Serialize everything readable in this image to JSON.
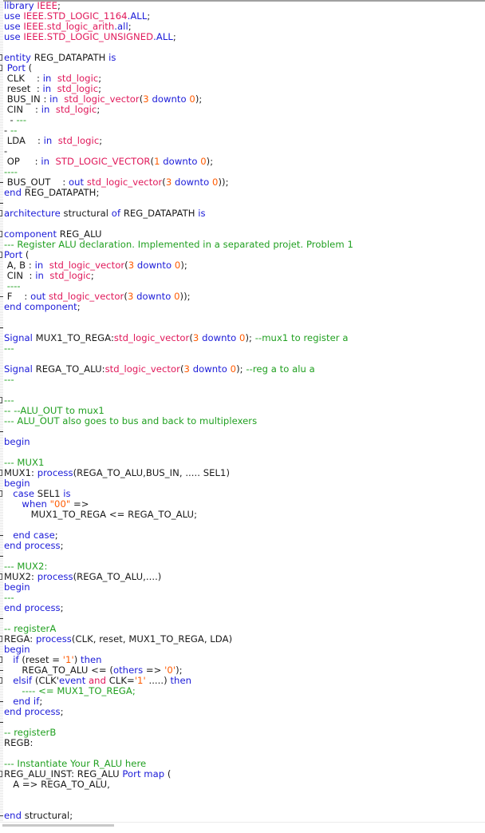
{
  "editor": {
    "language": "VHDL",
    "colors": {
      "keyword": "#1a1ad8",
      "type": "#e0185a",
      "number": "#ff5a00",
      "comment": "#21a021",
      "identifier": "#1a1a1a"
    },
    "lines": [
      {
        "marker": "",
        "tokens": [
          [
            "kw",
            "library "
          ],
          [
            "ty",
            "IEEE"
          ],
          [
            "id",
            ";"
          ]
        ]
      },
      {
        "marker": "",
        "tokens": [
          [
            "kw",
            "use "
          ],
          [
            "ty",
            "IEEE.STD_LOGIC_1164"
          ],
          [
            "kw",
            ".ALL"
          ],
          [
            "id",
            ";"
          ]
        ]
      },
      {
        "marker": "",
        "tokens": [
          [
            "kw",
            "use "
          ],
          [
            "ty",
            "IEEE.std_logic_arith"
          ],
          [
            "kw",
            ".all"
          ],
          [
            "id",
            ";"
          ]
        ]
      },
      {
        "marker": "",
        "tokens": [
          [
            "kw",
            "use "
          ],
          [
            "ty",
            "IEEE.STD_LOGIC_UNSIGNED"
          ],
          [
            "kw",
            ".ALL"
          ],
          [
            "id",
            ";"
          ]
        ]
      },
      {
        "marker": "",
        "tokens": []
      },
      {
        "marker": "fold",
        "tokens": [
          [
            "kw",
            "entity "
          ],
          [
            "id",
            "REG_DATAPATH "
          ],
          [
            "kw",
            "is"
          ]
        ]
      },
      {
        "marker": "fold",
        "tokens": [
          [
            "kw",
            " Port "
          ],
          [
            "id",
            "("
          ]
        ]
      },
      {
        "marker": "",
        "tokens": [
          [
            "id",
            " CLK    : "
          ],
          [
            "kw",
            "in  "
          ],
          [
            "ty",
            "std_logic"
          ],
          [
            "id",
            ";"
          ]
        ]
      },
      {
        "marker": "",
        "tokens": [
          [
            "id",
            " reset  : "
          ],
          [
            "kw",
            "in  "
          ],
          [
            "ty",
            "std_logic"
          ],
          [
            "id",
            ";"
          ]
        ]
      },
      {
        "marker": "",
        "tokens": [
          [
            "id",
            " BUS_IN : "
          ],
          [
            "kw",
            "in  "
          ],
          [
            "ty",
            "std_logic_vector"
          ],
          [
            "id",
            "("
          ],
          [
            "num",
            "3"
          ],
          [
            "kw",
            " downto "
          ],
          [
            "num",
            "0"
          ],
          [
            "id",
            "); "
          ]
        ]
      },
      {
        "marker": "",
        "tokens": [
          [
            "id",
            " CIN    : "
          ],
          [
            "kw",
            "in  "
          ],
          [
            "ty",
            "std_logic"
          ],
          [
            "id",
            ";"
          ]
        ]
      },
      {
        "marker": "",
        "tokens": [
          [
            "id",
            "  - "
          ],
          [
            "cm",
            "---"
          ]
        ]
      },
      {
        "marker": "",
        "tokens": [
          [
            "id",
            "- "
          ],
          [
            "cm",
            "--"
          ]
        ]
      },
      {
        "marker": "",
        "tokens": [
          [
            "id",
            " LDA    : "
          ],
          [
            "kw",
            "in  "
          ],
          [
            "ty",
            "std_logic"
          ],
          [
            "id",
            ";"
          ]
        ]
      },
      {
        "marker": "",
        "tokens": [
          [
            "id",
            "-"
          ]
        ]
      },
      {
        "marker": "",
        "tokens": [
          [
            "id",
            " OP     : "
          ],
          [
            "kw",
            "in  "
          ],
          [
            "ty",
            "STD_LOGIC_VECTOR"
          ],
          [
            "id",
            "("
          ],
          [
            "num",
            "1"
          ],
          [
            "kw",
            " downto "
          ],
          [
            "num",
            "0"
          ],
          [
            "id",
            ");"
          ]
        ]
      },
      {
        "marker": "",
        "tokens": [
          [
            "cm",
            "----"
          ]
        ]
      },
      {
        "marker": "dash",
        "tokens": [
          [
            "id",
            " BUS_OUT    : "
          ],
          [
            "kw",
            "out "
          ],
          [
            "ty",
            "std_logic_vector"
          ],
          [
            "id",
            "("
          ],
          [
            "num",
            "3"
          ],
          [
            "kw",
            " downto "
          ],
          [
            "num",
            "0"
          ],
          [
            "id",
            "));"
          ]
        ]
      },
      {
        "marker": "",
        "tokens": [
          [
            "kw",
            "end "
          ],
          [
            "id",
            "REG_DATAPATH;"
          ]
        ]
      },
      {
        "marker": "dash",
        "tokens": []
      },
      {
        "marker": "fold",
        "tokens": [
          [
            "kw",
            "architecture "
          ],
          [
            "id",
            "structural "
          ],
          [
            "kw",
            "of "
          ],
          [
            "id",
            "REG_DATAPATH "
          ],
          [
            "kw",
            "is"
          ]
        ]
      },
      {
        "marker": "",
        "tokens": []
      },
      {
        "marker": "fold",
        "tokens": [
          [
            "kw",
            "component "
          ],
          [
            "id",
            "REG_ALU"
          ]
        ]
      },
      {
        "marker": "",
        "tokens": [
          [
            "cm",
            "--- Register ALU declaration. Implemented in a separated projet. Problem 1"
          ]
        ]
      },
      {
        "marker": "fold",
        "tokens": [
          [
            "kw",
            "Port "
          ],
          [
            "id",
            "("
          ]
        ]
      },
      {
        "marker": "",
        "tokens": [
          [
            "id",
            " A, B : "
          ],
          [
            "kw",
            "in  "
          ],
          [
            "ty",
            "std_logic_vector"
          ],
          [
            "id",
            "("
          ],
          [
            "num",
            "3"
          ],
          [
            "kw",
            " downto "
          ],
          [
            "num",
            "0"
          ],
          [
            "id",
            ");"
          ]
        ]
      },
      {
        "marker": "",
        "tokens": [
          [
            "id",
            " CIN  : "
          ],
          [
            "kw",
            "in  "
          ],
          [
            "ty",
            "std_logic"
          ],
          [
            "id",
            ";"
          ]
        ]
      },
      {
        "marker": "",
        "tokens": [
          [
            "cm",
            " ----"
          ]
        ]
      },
      {
        "marker": "dash",
        "tokens": [
          [
            "id",
            " F    : "
          ],
          [
            "kw",
            "out "
          ],
          [
            "ty",
            "std_logic_vector"
          ],
          [
            "id",
            "("
          ],
          [
            "num",
            "3"
          ],
          [
            "kw",
            " downto "
          ],
          [
            "num",
            "0"
          ],
          [
            "id",
            "));"
          ]
        ]
      },
      {
        "marker": "",
        "tokens": [
          [
            "kw",
            "end component"
          ],
          [
            "id",
            ";"
          ]
        ]
      },
      {
        "marker": "",
        "tokens": []
      },
      {
        "marker": "dash",
        "tokens": []
      },
      {
        "marker": "",
        "tokens": [
          [
            "kw",
            "Signal "
          ],
          [
            "id",
            "MUX1_TO_REGA:"
          ],
          [
            "ty",
            "std_logic_vector"
          ],
          [
            "id",
            "("
          ],
          [
            "num",
            "3"
          ],
          [
            "kw",
            " downto "
          ],
          [
            "num",
            "0"
          ],
          [
            "id",
            "); "
          ],
          [
            "cm",
            "--mux1 to register a"
          ]
        ]
      },
      {
        "marker": "",
        "tokens": [
          [
            "cm",
            "---"
          ]
        ]
      },
      {
        "marker": "",
        "tokens": []
      },
      {
        "marker": "",
        "tokens": [
          [
            "kw",
            "Signal "
          ],
          [
            "id",
            "REGA_TO_ALU:"
          ],
          [
            "ty",
            "std_logic_vector"
          ],
          [
            "id",
            "("
          ],
          [
            "num",
            "3"
          ],
          [
            "kw",
            " downto "
          ],
          [
            "num",
            "0"
          ],
          [
            "id",
            "); "
          ],
          [
            "cm",
            "--reg a to alu a"
          ]
        ]
      },
      {
        "marker": "",
        "tokens": [
          [
            "cm",
            "---"
          ]
        ]
      },
      {
        "marker": "",
        "tokens": []
      },
      {
        "marker": "fold",
        "tokens": [
          [
            "cm",
            "---"
          ]
        ]
      },
      {
        "marker": "",
        "tokens": [
          [
            "cm",
            "-- --ALU_OUT to mux1"
          ]
        ]
      },
      {
        "marker": "",
        "tokens": [
          [
            "cm",
            "--- ALU_OUT also goes to bus and back to multiplexers"
          ]
        ]
      },
      {
        "marker": "dash",
        "tokens": []
      },
      {
        "marker": "",
        "tokens": [
          [
            "kw",
            "begin"
          ]
        ]
      },
      {
        "marker": "",
        "tokens": []
      },
      {
        "marker": "",
        "tokens": [
          [
            "cm",
            "--- MUX1"
          ]
        ]
      },
      {
        "marker": "fold",
        "tokens": [
          [
            "id",
            "MUX1: "
          ],
          [
            "kw",
            "process"
          ],
          [
            "id",
            "(REGA_TO_ALU,BUS_IN, ..... SEL1)"
          ]
        ]
      },
      {
        "marker": "",
        "tokens": [
          [
            "kw",
            "begin"
          ]
        ]
      },
      {
        "marker": "fold",
        "tokens": [
          [
            "kw",
            "   case "
          ],
          [
            "id",
            "SEL1 "
          ],
          [
            "kw",
            "is"
          ]
        ]
      },
      {
        "marker": "",
        "tokens": [
          [
            "kw",
            "      when "
          ],
          [
            "str",
            "\"00\""
          ],
          [
            "id",
            " =>"
          ]
        ]
      },
      {
        "marker": "",
        "tokens": [
          [
            "id",
            "         MUX1_TO_REGA <= REGA_TO_ALU;"
          ]
        ]
      },
      {
        "marker": "",
        "tokens": []
      },
      {
        "marker": "dash",
        "tokens": [
          [
            "kw",
            "   end case"
          ],
          [
            "id",
            ";"
          ]
        ]
      },
      {
        "marker": "",
        "tokens": [
          [
            "kw",
            "end process"
          ],
          [
            "id",
            ";"
          ]
        ]
      },
      {
        "marker": "dash",
        "tokens": []
      },
      {
        "marker": "",
        "tokens": [
          [
            "cm",
            "--- MUX2:"
          ]
        ]
      },
      {
        "marker": "fold",
        "tokens": [
          [
            "id",
            "MUX2: "
          ],
          [
            "kw",
            "process"
          ],
          [
            "id",
            "(REGA_TO_ALU,....)"
          ]
        ]
      },
      {
        "marker": "",
        "tokens": [
          [
            "kw",
            "begin"
          ]
        ]
      },
      {
        "marker": "",
        "tokens": [
          [
            "cm",
            "---"
          ]
        ]
      },
      {
        "marker": "",
        "tokens": [
          [
            "kw",
            "end process"
          ],
          [
            "id",
            ";"
          ]
        ]
      },
      {
        "marker": "dash",
        "tokens": []
      },
      {
        "marker": "",
        "tokens": [
          [
            "cm",
            "-- registerA"
          ]
        ]
      },
      {
        "marker": "fold",
        "tokens": [
          [
            "id",
            "REGA: "
          ],
          [
            "kw",
            "process"
          ],
          [
            "id",
            "(CLK, reset, MUX1_TO_REGA, LDA)"
          ]
        ]
      },
      {
        "marker": "",
        "tokens": [
          [
            "kw",
            "begin"
          ]
        ]
      },
      {
        "marker": "fold",
        "tokens": [
          [
            "kw",
            "   if "
          ],
          [
            "id",
            "(reset = "
          ],
          [
            "str",
            "'1'"
          ],
          [
            "id",
            ") "
          ],
          [
            "kw",
            "then"
          ]
        ]
      },
      {
        "marker": "dash",
        "tokens": [
          [
            "id",
            "      REGA_TO_ALU <= ("
          ],
          [
            "kw",
            "others"
          ],
          [
            "id",
            " => "
          ],
          [
            "str",
            "'0'"
          ],
          [
            "id",
            ");"
          ]
        ]
      },
      {
        "marker": "fold",
        "tokens": [
          [
            "kw",
            "   elsif "
          ],
          [
            "id",
            "(CLK'"
          ],
          [
            "kw",
            "event "
          ],
          [
            "op",
            "and "
          ],
          [
            "id",
            "CLK="
          ],
          [
            "str",
            "'1'"
          ],
          [
            "id",
            " .....) "
          ],
          [
            "kw",
            "then"
          ]
        ]
      },
      {
        "marker": "",
        "tokens": [
          [
            "cm",
            "      ---- <= MUX1_TO_REGA;"
          ]
        ]
      },
      {
        "marker": "dash",
        "tokens": [
          [
            "kw",
            "   end if"
          ],
          [
            "id",
            ";"
          ]
        ]
      },
      {
        "marker": "",
        "tokens": [
          [
            "kw",
            "end process"
          ],
          [
            "id",
            ";"
          ]
        ]
      },
      {
        "marker": "dash",
        "tokens": []
      },
      {
        "marker": "",
        "tokens": [
          [
            "cm",
            "-- registerB"
          ]
        ]
      },
      {
        "marker": "",
        "tokens": [
          [
            "id",
            "REGB:"
          ]
        ]
      },
      {
        "marker": "",
        "tokens": []
      },
      {
        "marker": "",
        "tokens": [
          [
            "cm",
            "--- Instantiate Your R_ALU here"
          ]
        ]
      },
      {
        "marker": "fold",
        "tokens": [
          [
            "id",
            "REG_ALU_INST: REG_ALU "
          ],
          [
            "kw",
            "Port map "
          ],
          [
            "id",
            "("
          ]
        ]
      },
      {
        "marker": "",
        "tokens": [
          [
            "id",
            "   A => REGA_TO_ALU,"
          ]
        ]
      },
      {
        "marker": "",
        "tokens": []
      },
      {
        "marker": "",
        "tokens": []
      },
      {
        "marker": "dash",
        "tokens": [
          [
            "kw",
            "end "
          ],
          [
            "id",
            "structural;"
          ]
        ]
      }
    ]
  }
}
